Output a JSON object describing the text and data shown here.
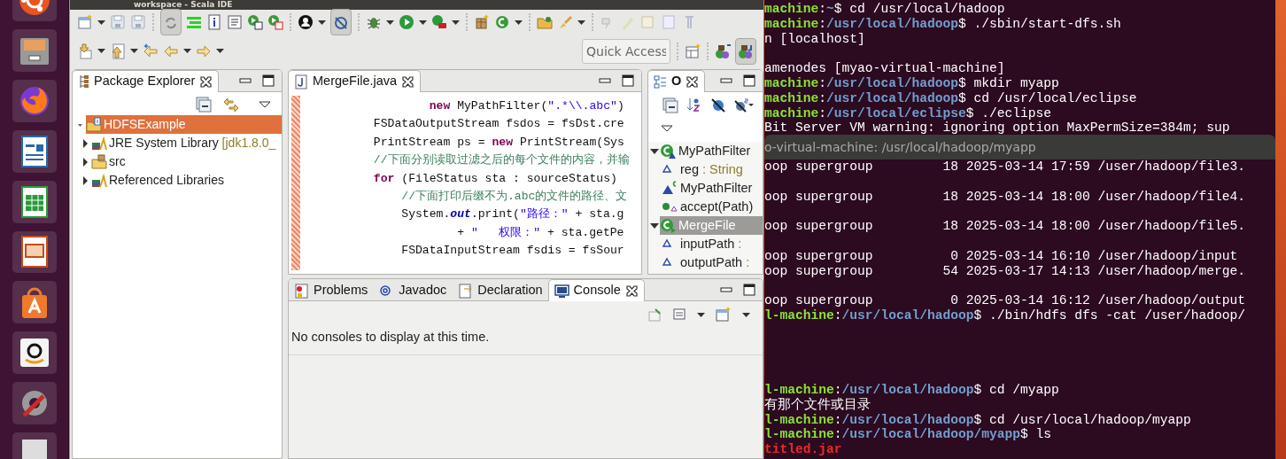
{
  "ide": {
    "title": "workspace - Scala IDE",
    "quick_access": {
      "placeholder": "Quick Access"
    },
    "package_explorer": {
      "tab": "Package Explorer",
      "tree": [
        {
          "label": "HDFSExample",
          "expanded": true,
          "selected": true,
          "children": [
            {
              "label": "JRE System Library",
              "detail": "[jdk1.8.0_",
              "expanded": false,
              "selected": false,
              "kind": "library"
            },
            {
              "label": "src",
              "expanded": false,
              "selected": false,
              "kind": "folder"
            },
            {
              "label": "Referenced Libraries",
              "expanded": false,
              "selected": false,
              "kind": "library"
            }
          ],
          "kind": "project"
        }
      ]
    },
    "editor": {
      "tab": "MergeFile.java",
      "lines": [
        {
          "segments": [
            {
              "kind": "keyword",
              "text": "                new"
            },
            {
              "kind": "plain",
              "text": " MyPathFilter("
            },
            {
              "kind": "string",
              "text": "\".*\\\\.abc\""
            },
            {
              "kind": "plain",
              "text": ")"
            }
          ]
        },
        {
          "segments": [
            {
              "kind": "plain",
              "text": "        FSDataOutputStream fsdos = fsDst.cre"
            }
          ]
        },
        {
          "segments": [
            {
              "kind": "plain",
              "text": "        PrintStream ps = "
            },
            {
              "kind": "keyword",
              "text": "new"
            },
            {
              "kind": "plain",
              "text": " PrintStream(Sys"
            }
          ]
        },
        {
          "segments": [
            {
              "kind": "comment",
              "text": "        //下面分别读取过滤之后的每个文件的内容，并输"
            }
          ]
        },
        {
          "segments": [
            {
              "kind": "keyword",
              "text": "        for"
            },
            {
              "kind": "plain",
              "text": " (FileStatus sta : sourceStatus)"
            }
          ]
        },
        {
          "segments": [
            {
              "kind": "comment",
              "text": "            //下面打印后缀不为.abc的文件的路径、文"
            }
          ]
        },
        {
          "segments": [
            {
              "kind": "plain",
              "text": "            System."
            },
            {
              "kind": "field",
              "text": "out"
            },
            {
              "kind": "plain",
              "text": ".print("
            },
            {
              "kind": "string",
              "text": "\"路径：\""
            },
            {
              "kind": "plain",
              "text": " + sta.g"
            }
          ]
        },
        {
          "segments": [
            {
              "kind": "plain",
              "text": "                    + "
            },
            {
              "kind": "string",
              "text": "\"   权限：\""
            },
            {
              "kind": "plain",
              "text": " + sta.getPe"
            }
          ]
        },
        {
          "segments": [
            {
              "kind": "plain",
              "text": "            FSDataInputStream fsdis = fsSour"
            }
          ]
        }
      ]
    },
    "outline": {
      "tab": "O",
      "tree": [
        {
          "kind": "class",
          "label": "MyPathFilter",
          "expanded": true,
          "selected": false,
          "children": [
            {
              "kind": "field",
              "label": "reg",
              "type": ": String",
              "selected": false
            },
            {
              "kind": "constructor",
              "label": "MyPathFilter",
              "selected": false
            },
            {
              "kind": "method",
              "label": "accept(Path)",
              "selected": false
            }
          ]
        },
        {
          "kind": "class",
          "label": "MergeFile",
          "expanded": true,
          "selected": true,
          "children": [
            {
              "kind": "field",
              "label": "inputPath",
              "type": ":",
              "selected": false
            },
            {
              "kind": "field",
              "label": "outputPath",
              "type": ":",
              "selected": false
            }
          ]
        }
      ]
    },
    "bottom_panel": {
      "tabs": [
        {
          "label": "Problems",
          "kind": "problems",
          "selected": false
        },
        {
          "label": "Javadoc",
          "kind": "javadoc",
          "selected": false
        },
        {
          "label": "Declaration",
          "kind": "declaration",
          "selected": false
        },
        {
          "label": "Console",
          "kind": "console",
          "selected": true
        }
      ],
      "message": "No consoles to display at this time."
    }
  },
  "terminal_back": {
    "lines": [
      {
        "kind": "text",
        "segments": [
          {
            "kind": "host",
            "text": "machine"
          },
          {
            "kind": "plain",
            "text": ":"
          },
          {
            "kind": "path",
            "text": "~"
          },
          {
            "kind": "plain",
            "text": "$ cd /usr/local/hadoop"
          }
        ]
      },
      {
        "kind": "text",
        "segments": [
          {
            "kind": "host",
            "text": "machine"
          },
          {
            "kind": "plain",
            "text": ":"
          },
          {
            "kind": "path",
            "text": "/usr/local/hadoop"
          },
          {
            "kind": "plain",
            "text": "$ ./sbin/start-dfs.sh"
          }
        ]
      },
      {
        "kind": "text",
        "segments": [
          {
            "kind": "plain",
            "text": "n [localhost]"
          }
        ]
      },
      {
        "kind": "blank"
      },
      {
        "kind": "text",
        "segments": [
          {
            "kind": "plain",
            "text": "amenodes [myao-virtual-machine]"
          }
        ]
      },
      {
        "kind": "text",
        "segments": [
          {
            "kind": "host",
            "text": "machine"
          },
          {
            "kind": "plain",
            "text": ":"
          },
          {
            "kind": "path",
            "text": "/usr/local/hadoop"
          },
          {
            "kind": "plain",
            "text": "$ mkdir myapp"
          }
        ]
      },
      {
        "kind": "text",
        "segments": [
          {
            "kind": "host",
            "text": "machine"
          },
          {
            "kind": "plain",
            "text": ":"
          },
          {
            "kind": "path",
            "text": "/usr/local/hadoop"
          },
          {
            "kind": "plain",
            "text": "$ cd /usr/local/eclipse"
          }
        ]
      },
      {
        "kind": "text",
        "segments": [
          {
            "kind": "host",
            "text": "machine"
          },
          {
            "kind": "plain",
            "text": ":"
          },
          {
            "kind": "path",
            "text": "/usr/local/eclipse"
          },
          {
            "kind": "plain",
            "text": "$ ./eclipse"
          }
        ]
      },
      {
        "kind": "text",
        "segments": [
          {
            "kind": "plain",
            "text": "Bit Server VM warning: ignoring option MaxPermSize=384m; sup"
          }
        ]
      }
    ]
  },
  "terminal_front": {
    "title": "o-virtual-machine: /usr/local/hadoop/myapp",
    "lines": [
      {
        "kind": "text",
        "segments": [
          {
            "kind": "plain",
            "text": "oop supergroup         18 2025-03-14 17:59 /user/hadoop/file3."
          }
        ]
      },
      {
        "kind": "blank"
      },
      {
        "kind": "text",
        "segments": [
          {
            "kind": "plain",
            "text": "oop supergroup         18 2025-03-14 18:00 /user/hadoop/file4."
          }
        ]
      },
      {
        "kind": "blank"
      },
      {
        "kind": "text",
        "segments": [
          {
            "kind": "plain",
            "text": "oop supergroup         18 2025-03-14 18:00 /user/hadoop/file5."
          }
        ]
      },
      {
        "kind": "blank"
      },
      {
        "kind": "text",
        "segments": [
          {
            "kind": "plain",
            "text": "oop supergroup          0 2025-03-14 16:10 /user/hadoop/input"
          }
        ]
      },
      {
        "kind": "text",
        "segments": [
          {
            "kind": "plain",
            "text": "oop supergroup         54 2025-03-17 14:13 /user/hadoop/merge."
          }
        ]
      },
      {
        "kind": "blank"
      },
      {
        "kind": "text",
        "segments": [
          {
            "kind": "plain",
            "text": "oop supergroup          0 2025-03-14 16:12 /user/hadoop/output"
          }
        ]
      },
      {
        "kind": "text",
        "segments": [
          {
            "kind": "host",
            "text": "l-machine"
          },
          {
            "kind": "plain",
            "text": ":"
          },
          {
            "kind": "path",
            "text": "/usr/local/hadoop"
          },
          {
            "kind": "plain",
            "text": "$ ./bin/hdfs dfs -cat /user/hadoop/"
          }
        ]
      },
      {
        "kind": "blank"
      },
      {
        "kind": "blank"
      },
      {
        "kind": "blank"
      },
      {
        "kind": "blank"
      },
      {
        "kind": "text",
        "segments": [
          {
            "kind": "host",
            "text": "l-machine"
          },
          {
            "kind": "plain",
            "text": ":"
          },
          {
            "kind": "path",
            "text": "/usr/local/hadoop"
          },
          {
            "kind": "plain",
            "text": "$ cd /myapp"
          }
        ]
      },
      {
        "kind": "text",
        "segments": [
          {
            "kind": "plain",
            "text": "有那个文件或目录"
          }
        ]
      },
      {
        "kind": "text",
        "segments": [
          {
            "kind": "host",
            "text": "l-machine"
          },
          {
            "kind": "plain",
            "text": ":"
          },
          {
            "kind": "path",
            "text": "/usr/local/hadoop"
          },
          {
            "kind": "plain",
            "text": "$ cd /usr/local/hadoop/myapp"
          }
        ]
      },
      {
        "kind": "text",
        "segments": [
          {
            "kind": "host",
            "text": "l-machine"
          },
          {
            "kind": "plain",
            "text": ":"
          },
          {
            "kind": "path",
            "text": "/usr/local/hadoop/myapp"
          },
          {
            "kind": "plain",
            "text": "$ ls"
          }
        ]
      },
      {
        "kind": "text",
        "segments": [
          {
            "kind": "error",
            "text": "titled.jar"
          }
        ]
      }
    ]
  }
}
